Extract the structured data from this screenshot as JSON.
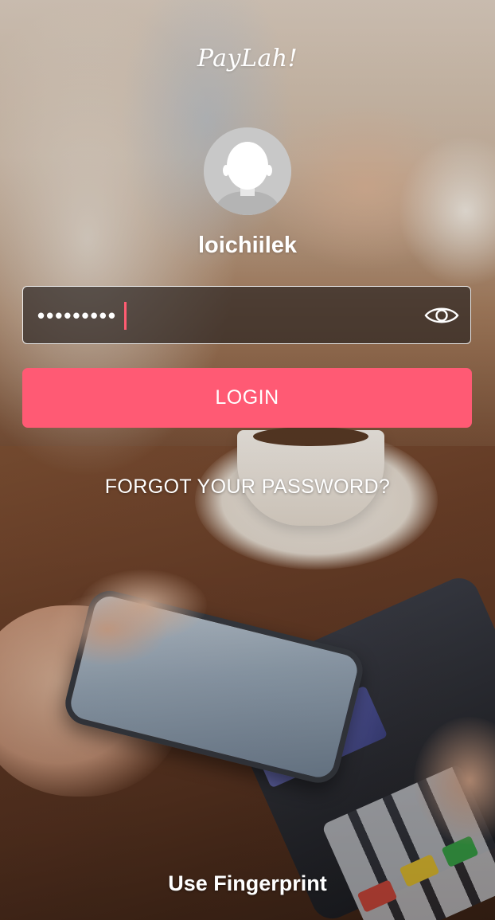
{
  "app": {
    "brand_name": "PayLah!"
  },
  "profile": {
    "username": "loichiilek",
    "avatar_icon": "default-user-avatar-icon"
  },
  "password_field": {
    "masked_value": "•••••••••",
    "visibility_icon": "eye-icon"
  },
  "actions": {
    "login_label": "LOGIN",
    "forgot_password_label": "FORGOT YOUR PASSWORD?",
    "fingerprint_label": "Use Fingerprint"
  },
  "colors": {
    "accent": "#ff5a74",
    "caret": "#ff5c72",
    "text": "#ffffff",
    "field_bg": "rgba(40,34,32,0.68)"
  }
}
